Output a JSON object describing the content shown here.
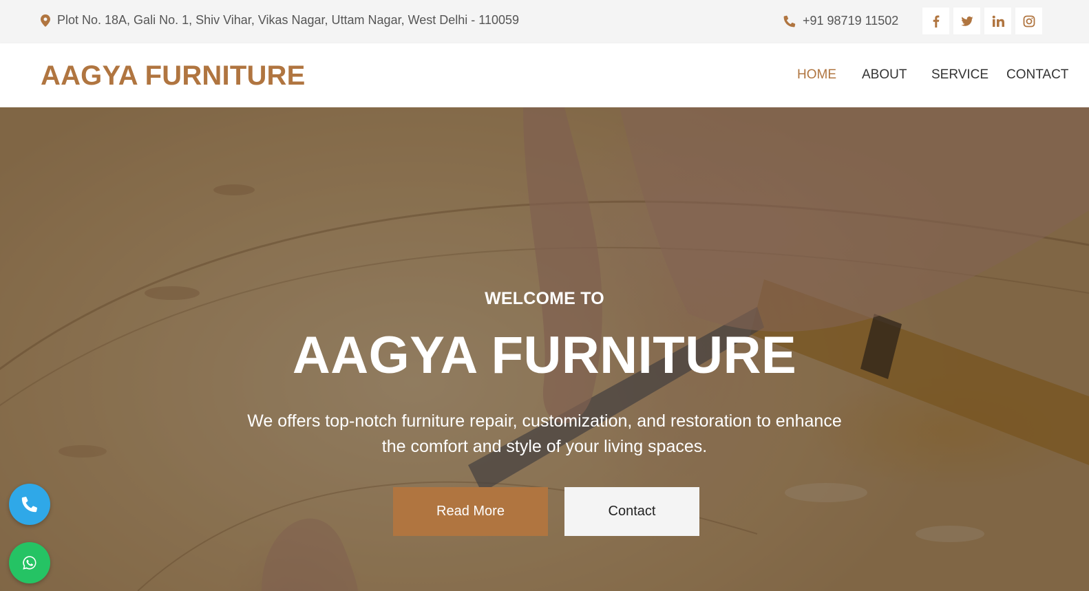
{
  "topbar": {
    "address": "Plot No. 18A, Gali No. 1, Shiv Vihar, Vikas Nagar, Uttam Nagar, West Delhi - 110059",
    "phone": "+91 98719 11502",
    "social": [
      "facebook-icon",
      "twitter-icon",
      "linkedin-icon",
      "instagram-icon"
    ]
  },
  "navbar": {
    "logo": "AAGYA FURNITURE",
    "links": [
      "HOME",
      "ABOUT",
      "SERVICE",
      "CONTACT"
    ],
    "active": "HOME"
  },
  "hero": {
    "welcome": "WELCOME TO",
    "title": "AAGYA FURNITURE",
    "description": "We offers top-notch furniture repair, customization, and restoration to enhance the comfort and style of your living spaces.",
    "primary_button": "Read More",
    "secondary_button": "Contact"
  },
  "floating": {
    "call_icon": "phone-icon",
    "whatsapp_icon": "whatsapp-icon"
  },
  "colors": {
    "accent": "#b07540",
    "topbar_bg": "#f4f4f4",
    "call_float": "#2fa8e8",
    "whatsapp_float": "#25c364"
  }
}
